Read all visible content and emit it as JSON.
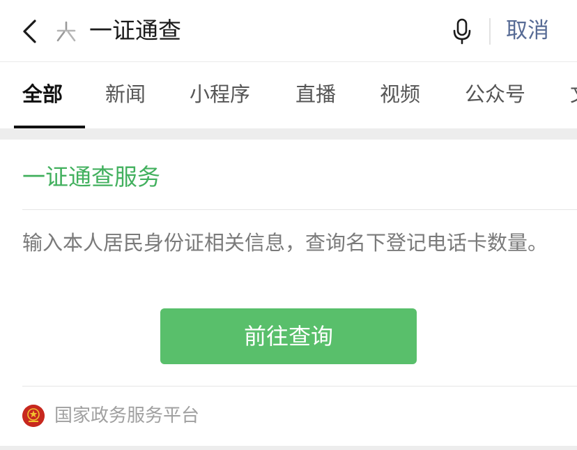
{
  "search": {
    "query": "一证通查",
    "cancel_label": "取消"
  },
  "tabs": [
    {
      "label": "全部",
      "active": true
    },
    {
      "label": "新闻",
      "active": false
    },
    {
      "label": "小程序",
      "active": false
    },
    {
      "label": "直播",
      "active": false
    },
    {
      "label": "视频",
      "active": false
    },
    {
      "label": "公众号",
      "active": false
    },
    {
      "label": "文",
      "active": false
    }
  ],
  "card": {
    "title": "一证通查服务",
    "description": "输入本人居民身份证相关信息，查询名下登记电话卡数量。",
    "button_label": "前往查询",
    "source_name": "国家政务服务平台"
  },
  "colors": {
    "accent_green": "#42b05e",
    "button_green": "#59bf6b",
    "cancel_blue": "#576b95"
  },
  "icons": {
    "back": "back-arrow-icon",
    "search": "wechat-search-icon",
    "mic": "microphone-icon",
    "emblem": "national-emblem-icon"
  }
}
